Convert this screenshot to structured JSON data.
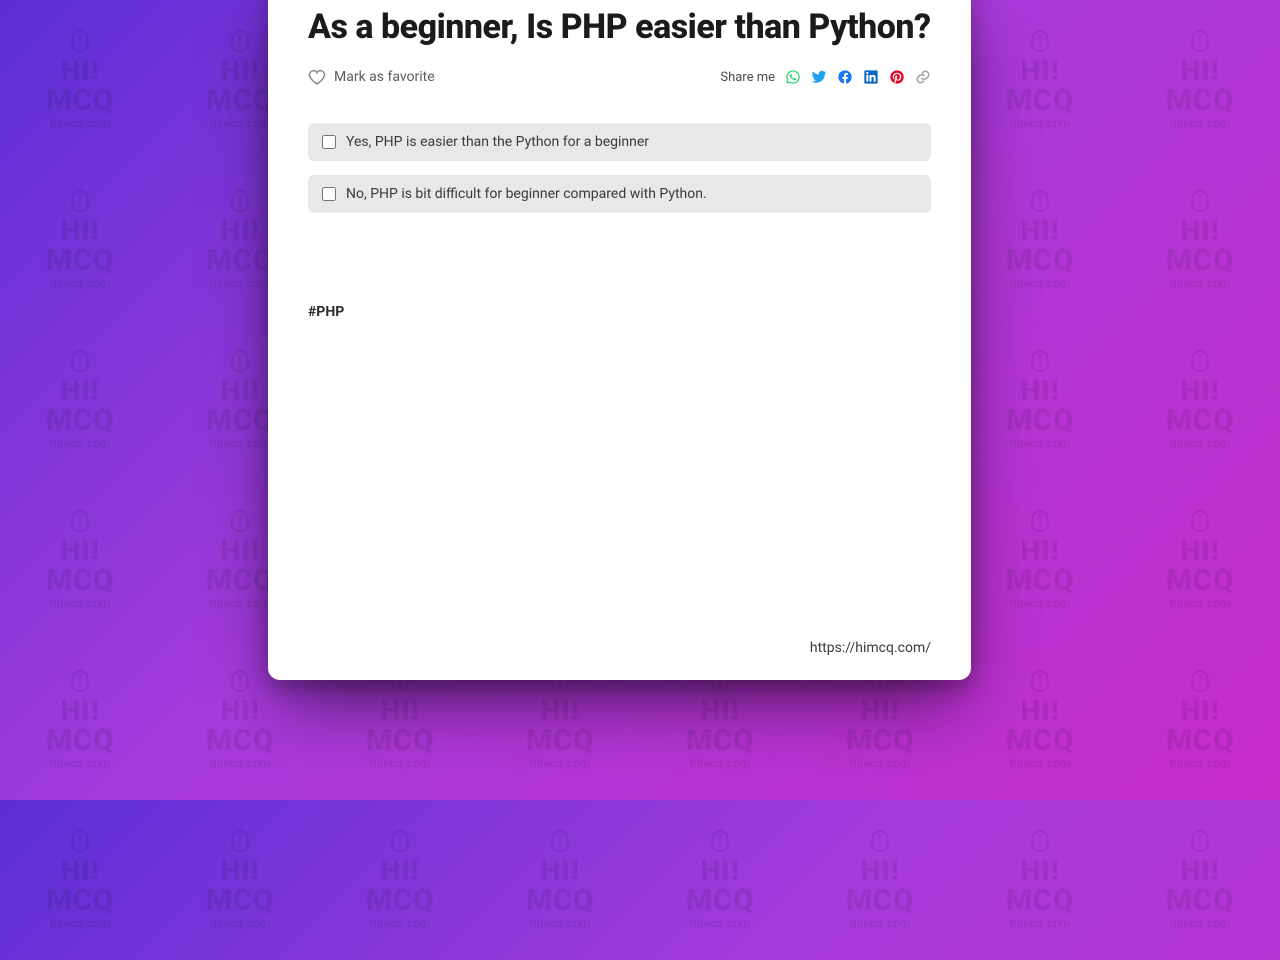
{
  "watermark": {
    "hi": "HI!",
    "mcq": "MCQ",
    "url": "himcq.com"
  },
  "question": "As a beginner, Is PHP easier than Python?",
  "favorite_label": "Mark as favorite",
  "share_label": "Share me",
  "options": [
    "Yes, PHP is easier than the Python for a beginner",
    "No, PHP is bit difficult for beginner compared with Python."
  ],
  "tag": "#PHP",
  "footer_url": "https://himcq.com/",
  "colors": {
    "whatsapp": "#25D366",
    "twitter": "#1DA1F2",
    "facebook": "#1877F2",
    "linkedin": "#0A66C2",
    "pinterest": "#E60023",
    "link": "#9e9e9e"
  }
}
